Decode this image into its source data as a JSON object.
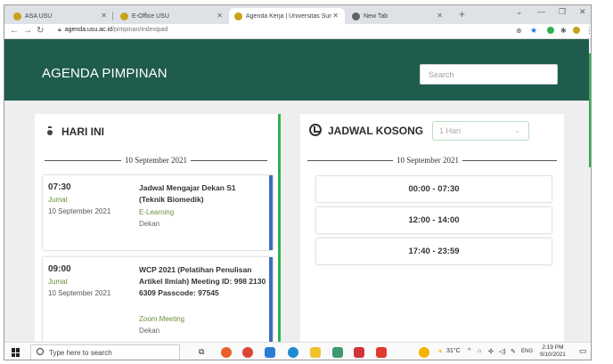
{
  "browser": {
    "tabs": [
      {
        "label": "ASA USU",
        "favicon": "usu-logo-icon",
        "color": "#c8a21a"
      },
      {
        "label": "E-Office USU",
        "favicon": "usu-logo-icon",
        "color": "#c8a21a"
      },
      {
        "label": "Agenda Kerja | Universitas Sumat",
        "favicon": "usu-logo-icon",
        "color": "#c8a21a",
        "active": true
      },
      {
        "label": "New Tab",
        "favicon": "globe-icon",
        "color": "#5f6368"
      }
    ],
    "url_host": "agenda.usu.ac.id",
    "url_path": "/pimpinan/indexipad"
  },
  "header": {
    "title": "AGENDA PIMPINAN",
    "search_placeholder": "Search",
    "bg_color": "#1f5c4d"
  },
  "today": {
    "title": "HARI INI",
    "date": "10 September 2021",
    "items": [
      {
        "time": "07:30",
        "day": "Jumat",
        "date": "10 September 2021",
        "title": "Jadwal Mengajar Dekan S1 (Teknik Biomedik)",
        "location": "E-Learning",
        "who": "Dekan"
      },
      {
        "time": "09:00",
        "day": "Jumat",
        "date": "10 September 2021",
        "title": "WCP 2021 (Pelatihan Penulisan Artikel Ilmiah) Meeting ID: 998 2130 6309 Passcode: 97545",
        "location": "Zoom Meeting",
        "who": "Dekan"
      }
    ]
  },
  "free_slots": {
    "title": "JADWAL KOSONG",
    "select_value": "1 Hari",
    "date": "10 September 2021",
    "slots": [
      "00:00 - 07:30",
      "12:00 - 14:00",
      "17:40 - 23:59"
    ]
  },
  "taskbar": {
    "search_placeholder": "Type here to search",
    "weather": "31°C",
    "lang": "ENG",
    "time": "2:19 PM",
    "date": "9/10/2021"
  },
  "colors": {
    "accent_green": "#2eb24e",
    "agenda_stripe": "#3f6fb5",
    "detail_green": "#6a8f3c"
  }
}
